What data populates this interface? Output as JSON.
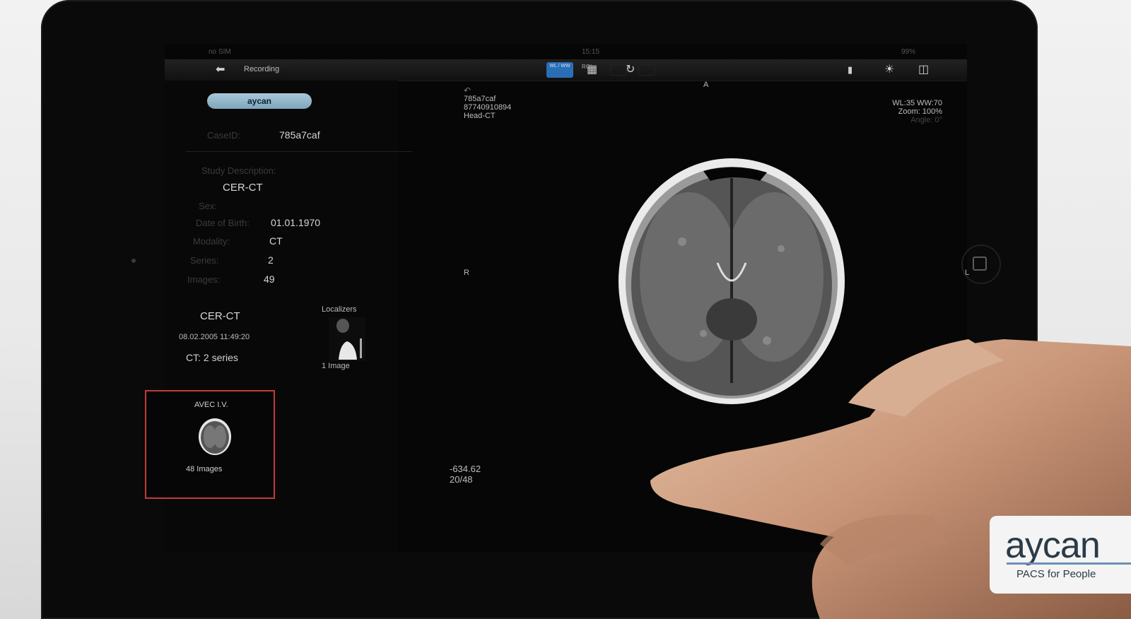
{
  "statusbar": {
    "carrier": "no SIM",
    "time": "15:15",
    "battery": "99%"
  },
  "toolbar": {
    "title": "Recording",
    "wl_button": "WL / WW",
    "roi_button": "ROI"
  },
  "viewer": {
    "orientation": {
      "top": "A",
      "left": "R",
      "right": "L"
    },
    "overlay_tl": {
      "case": "785a7caf",
      "patient_id": "87740910894",
      "desc": "Head-CT"
    },
    "overlay_tr": {
      "wl": "WL:35 WW:70",
      "zoom": "Zoom: 100%",
      "angle": "Angle: 0°"
    },
    "overlay_bl": {
      "position": "-634.62",
      "slice": "20/48"
    }
  },
  "patient": {
    "pill": "aycan",
    "caseid_label": "CaseID:",
    "caseid_value": "785a7caf",
    "study_desc_label": "Study Description:",
    "study_desc_value": "CER-CT",
    "sex_label": "Sex:",
    "dob_label": "Date of Birth:",
    "dob_value": "01.01.1970",
    "modality_label": "Modality:",
    "modality_value": "CT",
    "series_label": "Series:",
    "series_value": "2",
    "images_label": "Images:",
    "images_value": "49"
  },
  "study": {
    "title": "CER-CT",
    "date": "08.02.2005 11:49:20",
    "series_summary": "CT: 2 series"
  },
  "series_thumbs": [
    {
      "title": "Localizers",
      "count": "1 Image"
    },
    {
      "title": "AVEC I.V.",
      "count": "48 Images",
      "selected": true
    }
  ],
  "colors": {
    "selection": "#c53a3a",
    "pill": "#8fb5c9",
    "active_tool": "#2a6fb5"
  },
  "logo": {
    "brand": "aycan",
    "tagline": "PACS for People"
  },
  "icons": [
    "back-arrow-icon",
    "info-icon",
    "grid-layout-icon",
    "rotate-icon",
    "brightness-icon",
    "split-view-icon",
    "home-button-icon"
  ]
}
